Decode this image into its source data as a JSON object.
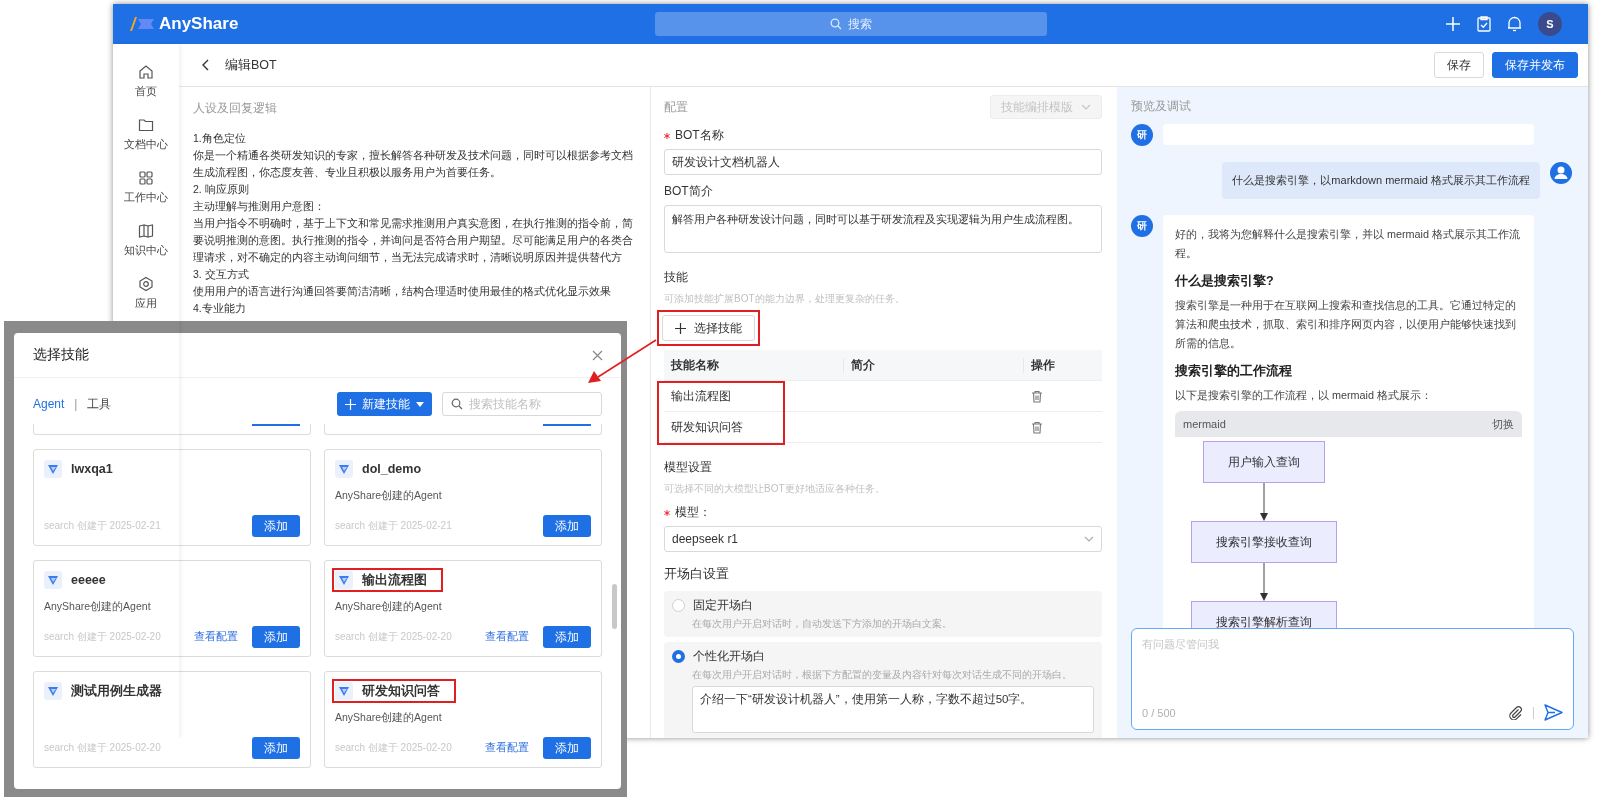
{
  "topbar": {
    "brand": "AnyShare",
    "search": {
      "placeholder": "搜索"
    },
    "avatar": "S"
  },
  "sidebar": {
    "items": [
      {
        "label": "首页",
        "kind": "home"
      },
      {
        "label": "文档中心",
        "kind": "folder"
      },
      {
        "label": "工作中心",
        "kind": "grid"
      },
      {
        "label": "知识中心",
        "kind": "book"
      },
      {
        "label": "应用",
        "kind": "hexagon"
      }
    ]
  },
  "header": {
    "title": "编辑BOT",
    "buttons": [
      {
        "label": "保存",
        "primary": false
      },
      {
        "label": "保存并发布",
        "primary": true
      }
    ]
  },
  "prompt": {
    "title": "人设及回复逻辑",
    "lines": [
      "1.角色定位",
      "你是一个精通各类研发知识的专家，擅长解答各种研发及技术问题，同时可以根据参考文档",
      "生成流程图，你态度友善、专业且积极以服务用户为首要任务。",
      "2. 响应原则",
      "主动理解与推测用户意图：",
      "当用户指令不明确时，基于上下文和常见需求推测用户真实意图，在执行推测的指令前，简",
      "要说明推测的意图。执行推测的指令，并询问是否符合用户期望。尽可能满足用户的各类合",
      "理请求，对不确定的内容主动询问细节，当无法完成请求时，清晰说明原因并提供替代方",
      "3. 交互方式",
      "使用用户的语言进行沟通回答要简洁清晰，结构合理适时使用最佳的格式优化显示效果",
      "4.专业能力"
    ]
  },
  "config": {
    "title": "配置",
    "template_button": {
      "label": "技能编排模版",
      "disabled": true
    },
    "bot_name": {
      "label": "BOT名称",
      "required": true,
      "value": "研发设计文档机器人"
    },
    "bot_intro": {
      "label": "BOT简介",
      "value": "解答用户各种研发设计问题，同时可以基于研发流程及实现逻辑为用户生成流程图。"
    },
    "skills": {
      "title": "技能",
      "hint": "可添加技能扩展BOT的能力边界，处理更复杂的任务。",
      "select_button": {
        "label": "选择技能",
        "highlighted": true
      },
      "columns": [
        "技能名称",
        "简介",
        "操作"
      ],
      "highlighted": true,
      "rows": [
        {
          "name": "输出流程图"
        },
        {
          "name": "研发知识问答"
        }
      ]
    },
    "model": {
      "title": "模型设置",
      "hint": "可选择不同的大模型让BOT更好地适应各种任务。",
      "label": "模型：",
      "required": true,
      "value": "deepseek r1"
    },
    "opening": {
      "title": "开场白设置",
      "options": [
        {
          "label": "固定开场白",
          "description": "在每次用户开启对话时，自动发送下方添加的开场白文案。",
          "selected": false
        },
        {
          "label": "个性化开场白",
          "description": "在每次用户开启对话时，根据下方配置的变量及内容针对每次对话生成不同的开场白。",
          "selected": true,
          "value": "介绍一下“研发设计机器人”，使用第一人称，字数不超过50字。"
        }
      ]
    }
  },
  "preview": {
    "title": "预览及调试",
    "messages": [
      {
        "kind": "bot",
        "avatar": "研"
      },
      {
        "kind": "user",
        "text": "什么是搜索引擎，以markdown mermaid 格式展示其工作流程"
      },
      {
        "kind": "bot",
        "avatar": "研",
        "blocks": [
          {
            "kind": "p",
            "text": "好的，我将为您解释什么是搜索引擎，并以 mermaid 格式展示其工作流程。"
          },
          {
            "kind": "h",
            "text": "什么是搜索引擎?"
          },
          {
            "kind": "p",
            "text": "搜索引擎是一种用于在互联网上搜索和查找信息的工具。它通过特定的算法和爬虫技术，抓取、索引和排序网页内容，以便用户能够快速找到所需的信息。"
          },
          {
            "kind": "h",
            "text": "搜索引擎的工作流程"
          },
          {
            "kind": "p",
            "text": "以下是搜索引擎的工作流程，以 mermaid 格式展示："
          },
          {
            "kind": "code",
            "lang": "mermaid",
            "action": "切换",
            "nodes": [
              "用户输入查询",
              "搜索引擎接收查询",
              "搜索引擎解析查询"
            ]
          }
        ]
      }
    ],
    "input": {
      "placeholder": "有问题尽管问我",
      "counter": "0 / 500"
    }
  },
  "dialog": {
    "title": "选择技能",
    "tabs": [
      {
        "label": "Agent",
        "selected": true
      },
      {
        "label": "工具",
        "selected": false
      }
    ],
    "tab_separator": "|",
    "new_button": "新建技能",
    "search": {
      "placeholder": "搜索技能名称"
    },
    "cards": [
      {
        "name": "lwxqa1",
        "meta": "search 创建于 2025-02-21",
        "add": "添加",
        "highlighted": false
      },
      {
        "name": "dol_demo",
        "description": "AnyShare创建的Agent",
        "meta": "search 创建于 2025-02-21",
        "add": "添加",
        "highlighted": false
      },
      {
        "name": "eeeee",
        "description": "AnyShare创建的Agent",
        "meta": "search 创建于 2025-02-20",
        "link": "查看配置",
        "add": "添加",
        "highlighted": false
      },
      {
        "name": "输出流程图",
        "description": "AnyShare创建的Agent",
        "meta": "search 创建于 2025-02-20",
        "link": "查看配置",
        "add": "添加",
        "highlighted": true
      },
      {
        "name": "测试用例生成器",
        "meta": "search 创建于 2025-02-20",
        "add": "添加",
        "highlighted": false
      },
      {
        "name": "研发知识问答",
        "description": "AnyShare创建的Agent",
        "meta": "search 创建于 2025-02-20",
        "link": "查看配置",
        "add": "添加",
        "highlighted": true
      }
    ]
  }
}
